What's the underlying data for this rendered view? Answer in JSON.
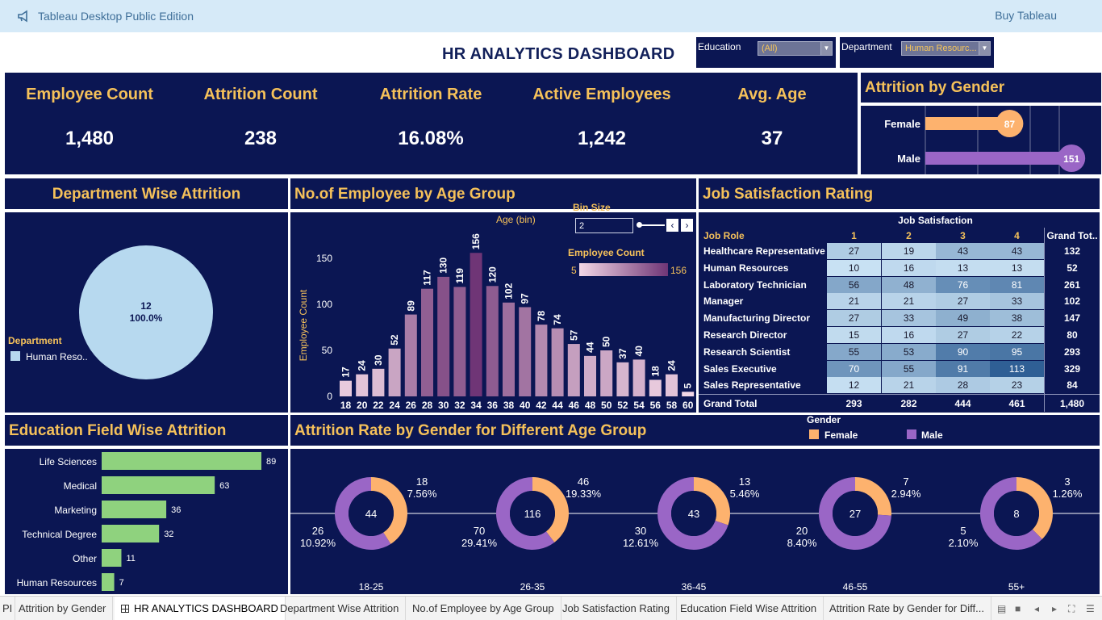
{
  "app": {
    "title": "Tableau Desktop Public Edition",
    "buy_label": "Buy Tableau"
  },
  "dashboard": {
    "title": "HR ANALYTICS DASHBOARD"
  },
  "filters": {
    "education": {
      "label": "Education",
      "value": "(All)"
    },
    "department": {
      "label": "Department",
      "value": "Human Resourc..."
    }
  },
  "kpis": [
    {
      "label": "Employee Count",
      "value": "1,480"
    },
    {
      "label": "Attrition Count",
      "value": "238"
    },
    {
      "label": "Attrition Rate",
      "value": "16.08%"
    },
    {
      "label": "Active Employees",
      "value": "1,242"
    },
    {
      "label": "Avg. Age",
      "value": "37"
    }
  ],
  "gender_attrition": {
    "title": "Attrition by Gender",
    "colors": {
      "Female": "#fdb26e",
      "Male": "#9a66c6"
    },
    "chart_data": {
      "type": "bar",
      "categories": [
        "Female",
        "Male"
      ],
      "values": [
        87,
        151
      ]
    }
  },
  "department_attrition": {
    "title": "Department Wise Attrition",
    "legend_title": "Department",
    "legend_item": "Human Reso..",
    "slice_count": "12",
    "slice_pct": "100.0%",
    "color": "#b7d9ef",
    "chart_data": {
      "type": "pie",
      "categories": [
        "Human Resources"
      ],
      "values": [
        12
      ],
      "percent": [
        100.0
      ]
    }
  },
  "age_group": {
    "title": "No.of Employee by Age Group",
    "xlabel": "Age (bin)",
    "ylabel": "Employee Count",
    "bin_size_label": "Bin Size",
    "bin_size_value": "2",
    "legend_title": "Employee Count",
    "legend_min": "5",
    "legend_max": "156",
    "yticks": [
      "0",
      "50",
      "100",
      "150"
    ],
    "chart_data": {
      "type": "bar",
      "categories": [
        "18",
        "20",
        "22",
        "24",
        "26",
        "28",
        "30",
        "32",
        "34",
        "36",
        "38",
        "40",
        "42",
        "44",
        "46",
        "48",
        "50",
        "52",
        "54",
        "56",
        "58",
        "60"
      ],
      "values": [
        17,
        24,
        30,
        52,
        89,
        117,
        130,
        119,
        156,
        120,
        102,
        97,
        78,
        74,
        57,
        44,
        50,
        37,
        40,
        18,
        24,
        5
      ],
      "ylim": [
        0,
        165
      ]
    }
  },
  "job_satisfaction": {
    "title": "Job Satisfaction Rating",
    "column_header": "Job Satisfaction",
    "row_header": "Job Role",
    "columns": [
      "1",
      "2",
      "3",
      "4"
    ],
    "total_label": "Grand Tot..",
    "grand_total_label": "Grand Total",
    "rows": [
      {
        "role": "Healthcare Representative",
        "values": [
          27,
          19,
          43,
          43
        ],
        "total": "132"
      },
      {
        "role": "Human Resources",
        "values": [
          10,
          16,
          13,
          13
        ],
        "total": "52"
      },
      {
        "role": "Laboratory Technician",
        "values": [
          56,
          48,
          76,
          81
        ],
        "total": "261"
      },
      {
        "role": "Manager",
        "values": [
          21,
          21,
          27,
          33
        ],
        "total": "102"
      },
      {
        "role": "Manufacturing Director",
        "values": [
          27,
          33,
          49,
          38
        ],
        "total": "147"
      },
      {
        "role": "Research Director",
        "values": [
          15,
          16,
          27,
          22
        ],
        "total": "80"
      },
      {
        "role": "Research Scientist",
        "values": [
          55,
          53,
          90,
          95
        ],
        "total": "293"
      },
      {
        "role": "Sales Executive",
        "values": [
          70,
          55,
          91,
          113
        ],
        "total": "329"
      },
      {
        "role": "Sales Representative",
        "values": [
          12,
          21,
          28,
          23
        ],
        "total": "84"
      }
    ],
    "grand_totals": [
      "293",
      "282",
      "444",
      "461",
      "1,480"
    ]
  },
  "education_field": {
    "title": "Education Field Wise Attrition",
    "color": "#8fd27e",
    "chart_data": {
      "type": "bar",
      "categories": [
        "Life Sciences",
        "Medical",
        "Marketing",
        "Technical Degree",
        "Other",
        "Human Resources"
      ],
      "values": [
        89,
        63,
        36,
        32,
        11,
        7
      ]
    }
  },
  "age_gender_rate": {
    "title": "Attrition Rate by Gender for Different Age Group",
    "legend_title": "Gender",
    "legend_items": [
      {
        "label": "Female",
        "color": "#fdb26e"
      },
      {
        "label": "Male",
        "color": "#9a66c6"
      }
    ],
    "chart_data": {
      "type": "pie",
      "groups": [
        {
          "age": "18-25",
          "total": "44",
          "female_count": "18",
          "female_pct": "7.56%",
          "male_count": "26",
          "male_pct": "10.92%",
          "female": 18,
          "male": 26
        },
        {
          "age": "26-35",
          "total": "116",
          "female_count": "46",
          "female_pct": "19.33%",
          "male_count": "70",
          "male_pct": "29.41%",
          "female": 46,
          "male": 70
        },
        {
          "age": "36-45",
          "total": "43",
          "female_count": "13",
          "female_pct": "5.46%",
          "male_count": "30",
          "male_pct": "12.61%",
          "female": 13,
          "male": 30
        },
        {
          "age": "46-55",
          "total": "27",
          "female_count": "7",
          "female_pct": "2.94%",
          "male_count": "20",
          "male_pct": "8.40%",
          "female": 7,
          "male": 20
        },
        {
          "age": "55+",
          "total": "8",
          "female_count": "3",
          "female_pct": "1.26%",
          "male_count": "5",
          "male_pct": "2.10%",
          "female": 3,
          "male": 5
        }
      ]
    }
  },
  "tabs": [
    {
      "label": "PI"
    },
    {
      "label": "Attrition by Gender"
    },
    {
      "label": "HR ANALYTICS DASHBOARD",
      "active": true
    },
    {
      "label": "Department Wise Attrition"
    },
    {
      "label": "No.of Employee by Age Group"
    },
    {
      "label": "Job Satisfaction Rating"
    },
    {
      "label": "Education Field Wise Attrition"
    },
    {
      "label": "Attrition Rate by Gender for Diff..."
    }
  ],
  "theme": {
    "panel_bg": "#0b1653",
    "accent": "#f5c15a"
  }
}
